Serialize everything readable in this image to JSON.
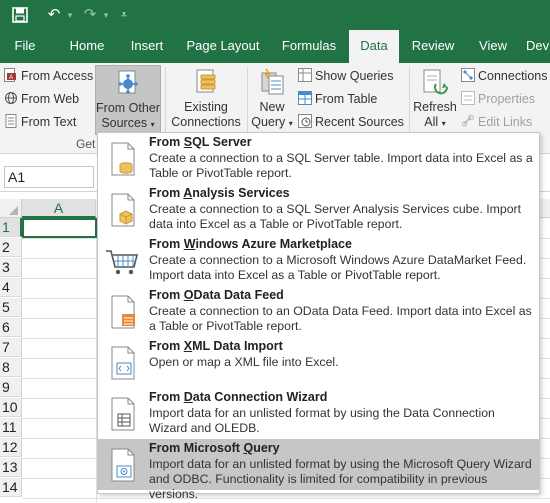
{
  "title_bar": {
    "save_icon": "save-icon",
    "undo_icon": "undo-icon",
    "redo_icon": "redo-icon",
    "customize_icon": "customize-qat-icon"
  },
  "tabs": [
    "File",
    "Home",
    "Insert",
    "Page Layout",
    "Formulas",
    "Data",
    "Review",
    "View",
    "Dev"
  ],
  "active_tab": "Data",
  "ribbon": {
    "from_access": "From Access",
    "from_web": "From Web",
    "from_text": "From Text",
    "from_other_sources_line1": "From Other",
    "from_other_sources_line2": "Sources",
    "existing_connections_line1": "Existing",
    "existing_connections_line2": "Connections",
    "new_query_line1": "New",
    "new_query_line2": "Query",
    "show_queries": "Show Queries",
    "from_table": "From Table",
    "recent_sources": "Recent Sources",
    "refresh_all_line1": "Refresh",
    "refresh_all_line2": "All",
    "connections": "Connections",
    "properties": "Properties",
    "edit_links": "Edit Links",
    "group_label_partial": "Get"
  },
  "name_box": "A1",
  "column_header": "A",
  "row_numbers": [
    "1",
    "2",
    "3",
    "4",
    "5",
    "6",
    "7",
    "8",
    "9",
    "10",
    "11",
    "12",
    "13",
    "14"
  ],
  "menu": [
    {
      "pre": "From ",
      "key": "S",
      "post": "QL Server",
      "desc": "Create a connection to a SQL Server table. Import data into Excel as a Table or PivotTable report.",
      "icon": "sql-server-icon"
    },
    {
      "pre": "From ",
      "key": "A",
      "post": "nalysis Services",
      "desc": "Create a connection to a SQL Server Analysis Services cube. Import data into Excel as a Table or PivotTable report.",
      "icon": "analysis-services-icon"
    },
    {
      "pre": "From ",
      "key": "W",
      "post": "indows Azure Marketplace",
      "desc": "Create a connection to a Microsoft Windows Azure DataMarket Feed. Import data into Excel as a Table or PivotTable report.",
      "icon": "azure-marketplace-icon"
    },
    {
      "pre": "From ",
      "key": "O",
      "post": "Data Data Feed",
      "desc": "Create a connection to an OData Data Feed. Import data into Excel as a Table or PivotTable report.",
      "icon": "odata-feed-icon"
    },
    {
      "pre": "From ",
      "key": "X",
      "post": "ML Data Import",
      "desc": "Open or map a XML file into Excel.",
      "icon": "xml-import-icon"
    },
    {
      "pre": "From ",
      "key": "D",
      "post": "ata Connection Wizard",
      "desc": "Import data for an unlisted format by using the Data Connection Wizard and OLEDB.",
      "icon": "data-connection-wizard-icon"
    },
    {
      "pre": "From Microsoft ",
      "key": "Q",
      "post": "uery",
      "desc": "Import data for an unlisted format by using the Microsoft Query Wizard and ODBC. Functionality is limited for compatibility in previous versions.",
      "icon": "microsoft-query-icon"
    }
  ],
  "colors": {
    "excel_green": "#217346",
    "highlight": "#c6c6c6"
  }
}
